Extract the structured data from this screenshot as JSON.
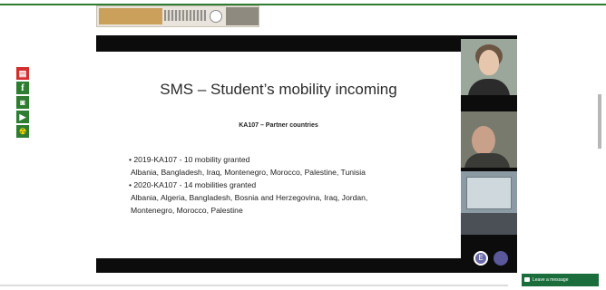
{
  "slide": {
    "title": "SMS – Student’s mobility incoming",
    "subtitle": "KA107 – Partner countries",
    "bullets": [
      {
        "heading": "2019-KA107 - 10 mobility granted",
        "countries": "Albania, Bangladesh, Iraq, Montenegro, Morocco, Palestine, Tunisia"
      },
      {
        "heading": "2020-KA107 - 14 mobilities granted",
        "countries_line1": "Albania, Algeria, Bangladesh, Bosnia and Herzegovina, Iraq, Jordan,",
        "countries_line2": "Montenegro, Morocco, Palestine"
      }
    ]
  },
  "bullet_char": "•",
  "participants": [
    {
      "initial": "E"
    },
    {
      "initial": ""
    }
  ],
  "social_icons": [
    "pdf-icon",
    "facebook-icon",
    "camera-icon",
    "youtube-icon",
    "hazard-icon"
  ],
  "social_glyphs": {
    "fb": "f",
    "yt": "▶",
    "hz": "☢",
    "cam": "◙",
    "pdf": "▤"
  },
  "chat": {
    "label": "Leave a message"
  },
  "colors": {
    "accent_green": "#2e7d32",
    "pdf_red": "#d32f2f",
    "chat_green": "#1b6e3c"
  }
}
